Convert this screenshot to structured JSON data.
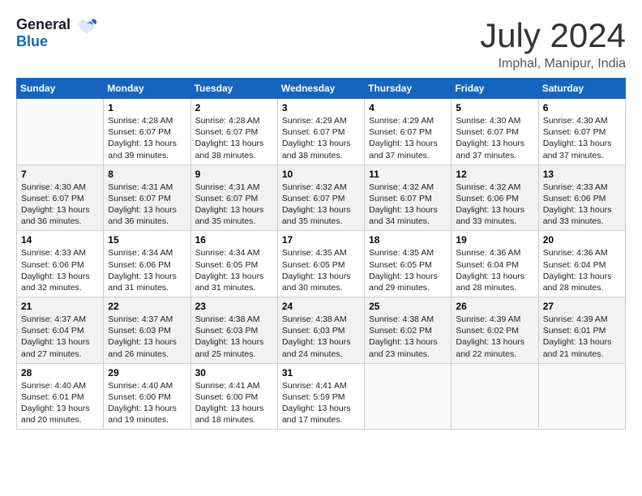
{
  "header": {
    "logo_general": "General",
    "logo_blue": "Blue",
    "title": "July 2024",
    "location": "Imphal, Manipur, India"
  },
  "calendar": {
    "days_of_week": [
      "Sunday",
      "Monday",
      "Tuesday",
      "Wednesday",
      "Thursday",
      "Friday",
      "Saturday"
    ],
    "weeks": [
      [
        {
          "day": "",
          "empty": true
        },
        {
          "day": "1",
          "sunrise": "4:28 AM",
          "sunset": "6:07 PM",
          "daylight": "13 hours and 39 minutes."
        },
        {
          "day": "2",
          "sunrise": "4:28 AM",
          "sunset": "6:07 PM",
          "daylight": "13 hours and 38 minutes."
        },
        {
          "day": "3",
          "sunrise": "4:29 AM",
          "sunset": "6:07 PM",
          "daylight": "13 hours and 38 minutes."
        },
        {
          "day": "4",
          "sunrise": "4:29 AM",
          "sunset": "6:07 PM",
          "daylight": "13 hours and 37 minutes."
        },
        {
          "day": "5",
          "sunrise": "4:30 AM",
          "sunset": "6:07 PM",
          "daylight": "13 hours and 37 minutes."
        },
        {
          "day": "6",
          "sunrise": "4:30 AM",
          "sunset": "6:07 PM",
          "daylight": "13 hours and 37 minutes."
        }
      ],
      [
        {
          "day": "7",
          "sunrise": "4:30 AM",
          "sunset": "6:07 PM",
          "daylight": "13 hours and 36 minutes."
        },
        {
          "day": "8",
          "sunrise": "4:31 AM",
          "sunset": "6:07 PM",
          "daylight": "13 hours and 36 minutes."
        },
        {
          "day": "9",
          "sunrise": "4:31 AM",
          "sunset": "6:07 PM",
          "daylight": "13 hours and 35 minutes."
        },
        {
          "day": "10",
          "sunrise": "4:32 AM",
          "sunset": "6:07 PM",
          "daylight": "13 hours and 35 minutes."
        },
        {
          "day": "11",
          "sunrise": "4:32 AM",
          "sunset": "6:07 PM",
          "daylight": "13 hours and 34 minutes."
        },
        {
          "day": "12",
          "sunrise": "4:32 AM",
          "sunset": "6:06 PM",
          "daylight": "13 hours and 33 minutes."
        },
        {
          "day": "13",
          "sunrise": "4:33 AM",
          "sunset": "6:06 PM",
          "daylight": "13 hours and 33 minutes."
        }
      ],
      [
        {
          "day": "14",
          "sunrise": "4:33 AM",
          "sunset": "6:06 PM",
          "daylight": "13 hours and 32 minutes."
        },
        {
          "day": "15",
          "sunrise": "4:34 AM",
          "sunset": "6:06 PM",
          "daylight": "13 hours and 31 minutes."
        },
        {
          "day": "16",
          "sunrise": "4:34 AM",
          "sunset": "6:05 PM",
          "daylight": "13 hours and 31 minutes."
        },
        {
          "day": "17",
          "sunrise": "4:35 AM",
          "sunset": "6:05 PM",
          "daylight": "13 hours and 30 minutes."
        },
        {
          "day": "18",
          "sunrise": "4:35 AM",
          "sunset": "6:05 PM",
          "daylight": "13 hours and 29 minutes."
        },
        {
          "day": "19",
          "sunrise": "4:36 AM",
          "sunset": "6:04 PM",
          "daylight": "13 hours and 28 minutes."
        },
        {
          "day": "20",
          "sunrise": "4:36 AM",
          "sunset": "6:04 PM",
          "daylight": "13 hours and 28 minutes."
        }
      ],
      [
        {
          "day": "21",
          "sunrise": "4:37 AM",
          "sunset": "6:04 PM",
          "daylight": "13 hours and 27 minutes."
        },
        {
          "day": "22",
          "sunrise": "4:37 AM",
          "sunset": "6:03 PM",
          "daylight": "13 hours and 26 minutes."
        },
        {
          "day": "23",
          "sunrise": "4:38 AM",
          "sunset": "6:03 PM",
          "daylight": "13 hours and 25 minutes."
        },
        {
          "day": "24",
          "sunrise": "4:38 AM",
          "sunset": "6:03 PM",
          "daylight": "13 hours and 24 minutes."
        },
        {
          "day": "25",
          "sunrise": "4:38 AM",
          "sunset": "6:02 PM",
          "daylight": "13 hours and 23 minutes."
        },
        {
          "day": "26",
          "sunrise": "4:39 AM",
          "sunset": "6:02 PM",
          "daylight": "13 hours and 22 minutes."
        },
        {
          "day": "27",
          "sunrise": "4:39 AM",
          "sunset": "6:01 PM",
          "daylight": "13 hours and 21 minutes."
        }
      ],
      [
        {
          "day": "28",
          "sunrise": "4:40 AM",
          "sunset": "6:01 PM",
          "daylight": "13 hours and 20 minutes."
        },
        {
          "day": "29",
          "sunrise": "4:40 AM",
          "sunset": "6:00 PM",
          "daylight": "13 hours and 19 minutes."
        },
        {
          "day": "30",
          "sunrise": "4:41 AM",
          "sunset": "6:00 PM",
          "daylight": "13 hours and 18 minutes."
        },
        {
          "day": "31",
          "sunrise": "4:41 AM",
          "sunset": "5:59 PM",
          "daylight": "13 hours and 17 minutes."
        },
        {
          "day": "",
          "empty": true
        },
        {
          "day": "",
          "empty": true
        },
        {
          "day": "",
          "empty": true
        }
      ]
    ]
  }
}
